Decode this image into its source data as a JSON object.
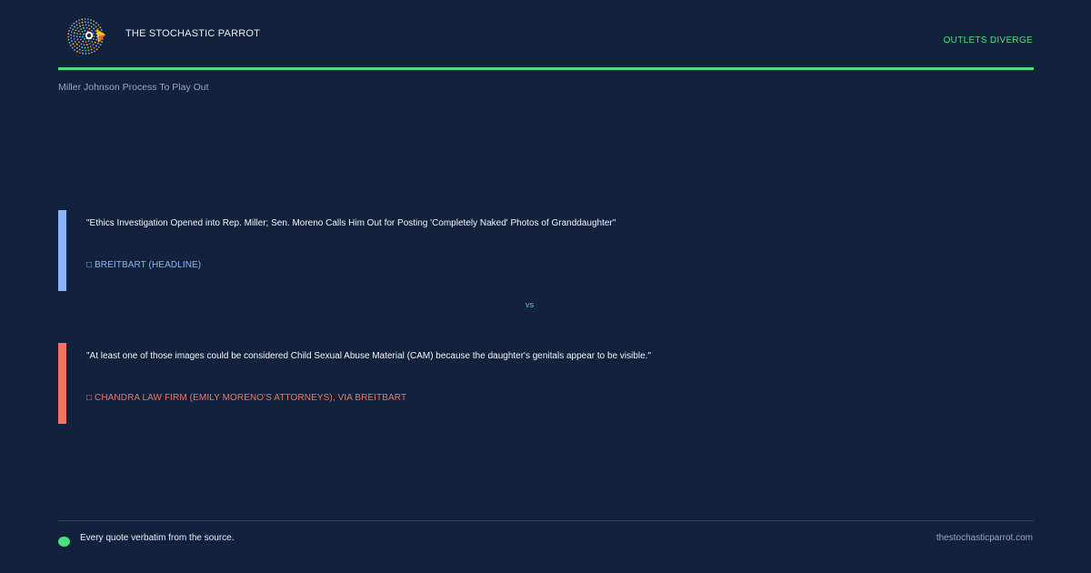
{
  "header": {
    "brand": "THE STOCHASTIC PARROT",
    "verdict": "OUTLETS DIVERGE"
  },
  "story": {
    "title": "Miller Johnson Process To Play Out"
  },
  "quotes": [
    {
      "text": "\"Ethics Investigation Opened into Rep. Miller; Sen. Moreno Calls Him Out for Posting 'Completely Naked' Photos of Granddaughter\"",
      "source": "□ BREITBART (HEADLINE)"
    },
    {
      "text": "\"At least one of those images could be considered Child Sexual Abuse Material (CAM) because the daughter's genitals appear to be visible.\"",
      "source": "□ CHANDRA LAW FIRM (EMILY MORENO'S ATTORNEYS), VIA BREITBART"
    }
  ],
  "divider": {
    "label": "vs"
  },
  "footer": {
    "note": "Every quote verbatim from the source.",
    "site": "thestochasticparrot.com"
  },
  "colors": {
    "background": "#12223d",
    "accent": "#4ade80",
    "source_a": "#8ab4f8",
    "source_b": "#f27263"
  },
  "icons": {
    "logo": "parrot-logo-icon",
    "footer_dot": "green-dot-icon"
  }
}
